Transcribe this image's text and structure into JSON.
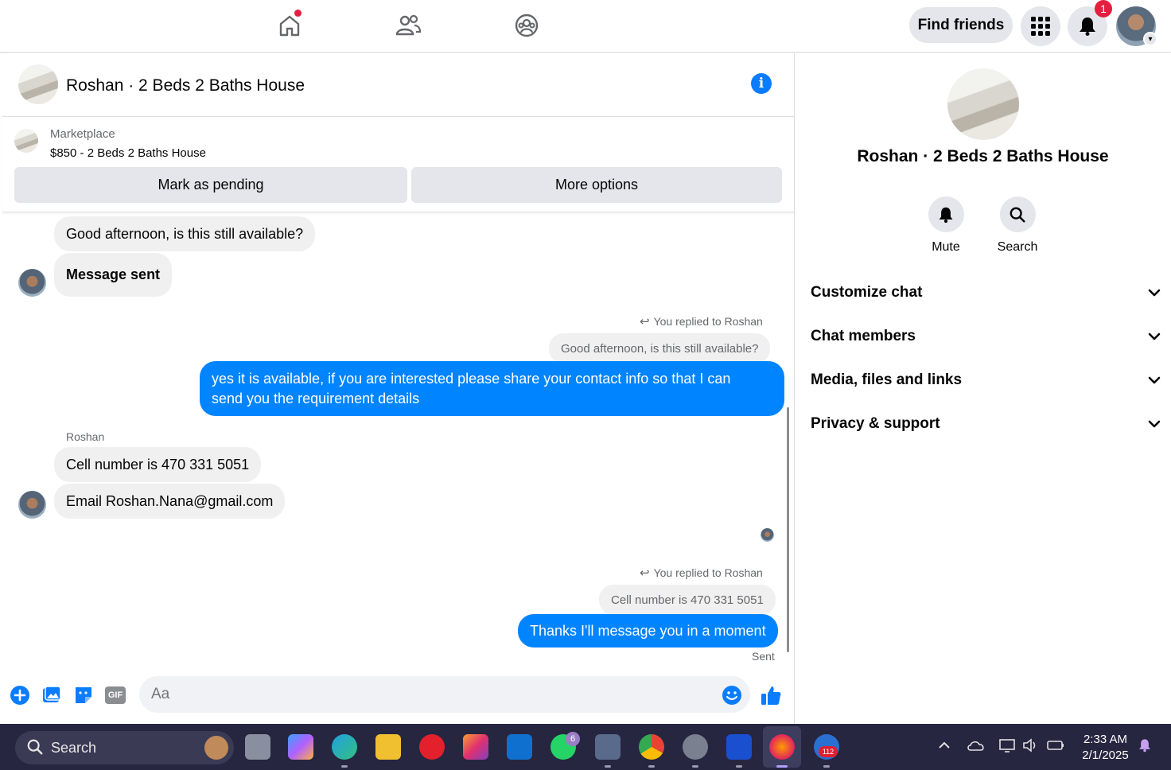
{
  "topbar": {
    "find_friends": "Find friends",
    "notification_count": "1",
    "nav_icons": [
      "home-icon",
      "friends-icon",
      "groups-icon"
    ]
  },
  "chat": {
    "title": "Roshan · 2 Beds 2 Baths House",
    "marketplace": {
      "label": "Marketplace",
      "item": "$850 - 2 Beds 2 Baths House",
      "mark_pending": "Mark as pending",
      "more_options": "More options"
    },
    "messages": {
      "m1": "Good afternoon, is this still available?",
      "m2": "Message sent",
      "reply1_label": "You replied to Roshan",
      "reply1_quote": "Good afternoon, is this still available?",
      "reply1_line1": "yes it is available, if you are interested please share your contact info so that I can",
      "reply1_line2": "send you the requirement details",
      "sender": "Roshan",
      "m3": "Cell number is 470 331 5051",
      "m4": "Email Roshan.Nana@gmail.com",
      "reply2_label": "You replied to Roshan",
      "reply2_quote": "Cell number is 470 331 5051",
      "reply2_text": "Thanks I'll message you in a moment",
      "status": "Sent"
    },
    "composer": {
      "placeholder": "Aa",
      "gif": "GIF"
    }
  },
  "sidebar": {
    "title": "Roshan · 2 Beds 2 Baths House",
    "mute": "Mute",
    "search": "Search",
    "sections": [
      "Customize chat",
      "Chat members",
      "Media, files and links",
      "Privacy & support"
    ]
  },
  "taskbar": {
    "search": "Search",
    "whatsapp_badge": "6",
    "app_badge": "112",
    "time": "2:33 AM",
    "date": "2/1/2025"
  },
  "colors": {
    "accent": "#0084ff",
    "notification": "#e41e3f",
    "taskbar": "#262640"
  }
}
